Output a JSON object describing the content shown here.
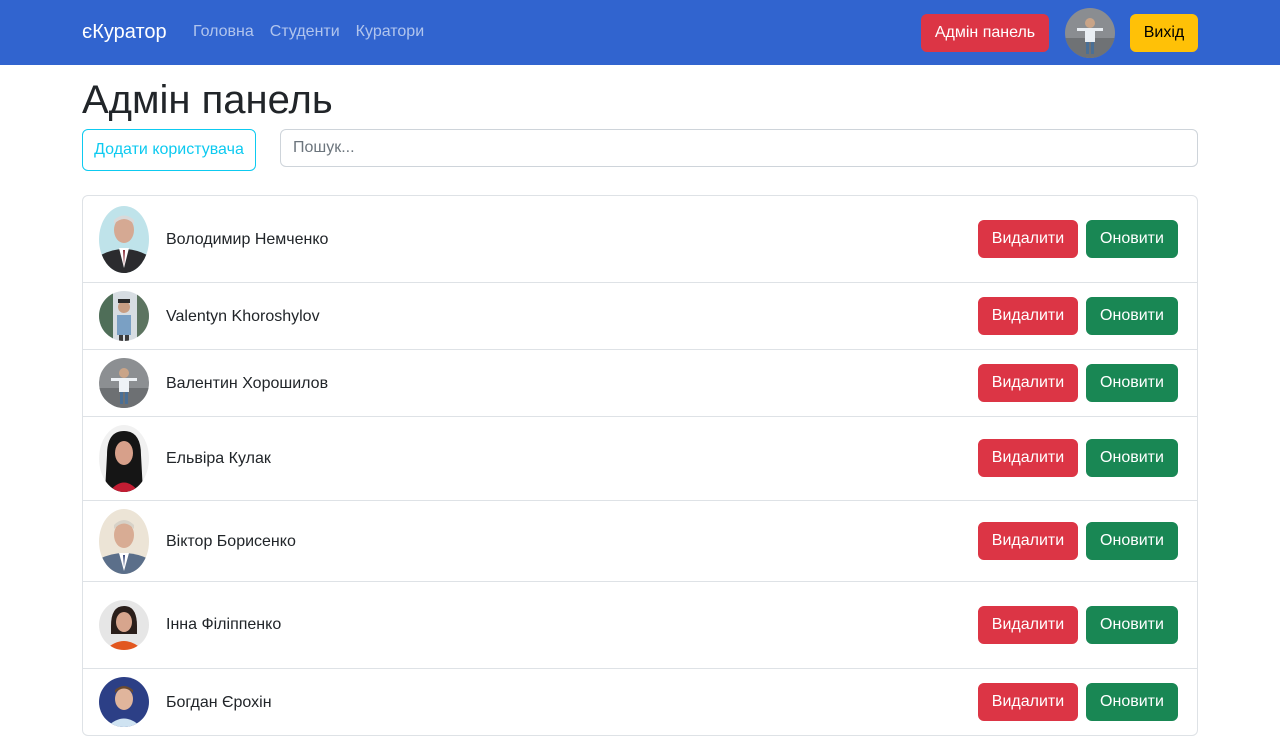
{
  "navbar": {
    "brand": "єКуратор",
    "links": [
      "Головна",
      "Студенти",
      "Куратори"
    ],
    "admin_button": "Адмін панель",
    "exit_button": "Вихід"
  },
  "page": {
    "title": "Адмін панель",
    "add_user_button": "Додати користувача",
    "search_placeholder": "Пошук..."
  },
  "users": [
    {
      "name": "Володимир Немченко",
      "delete_label": "Видалити",
      "update_label": "Оновити"
    },
    {
      "name": "Valentyn Khoroshylov",
      "delete_label": "Видалити",
      "update_label": "Оновити"
    },
    {
      "name": "Валентин Хорошилов",
      "delete_label": "Видалити",
      "update_label": "Оновити"
    },
    {
      "name": "Ельвіра Кулак",
      "delete_label": "Видалити",
      "update_label": "Оновити"
    },
    {
      "name": "Віктор Борисенко",
      "delete_label": "Видалити",
      "update_label": "Оновити"
    },
    {
      "name": "Інна Філіппенко",
      "delete_label": "Видалити",
      "update_label": "Оновити"
    },
    {
      "name": "Богдан Єрохін",
      "delete_label": "Видалити",
      "update_label": "Оновити"
    }
  ],
  "colors": {
    "navbar": "#3164cf",
    "danger": "#dc3545",
    "success": "#198754",
    "warning": "#ffc107",
    "info": "#0dcaf0"
  },
  "icons": [
    "avatar-photo"
  ]
}
